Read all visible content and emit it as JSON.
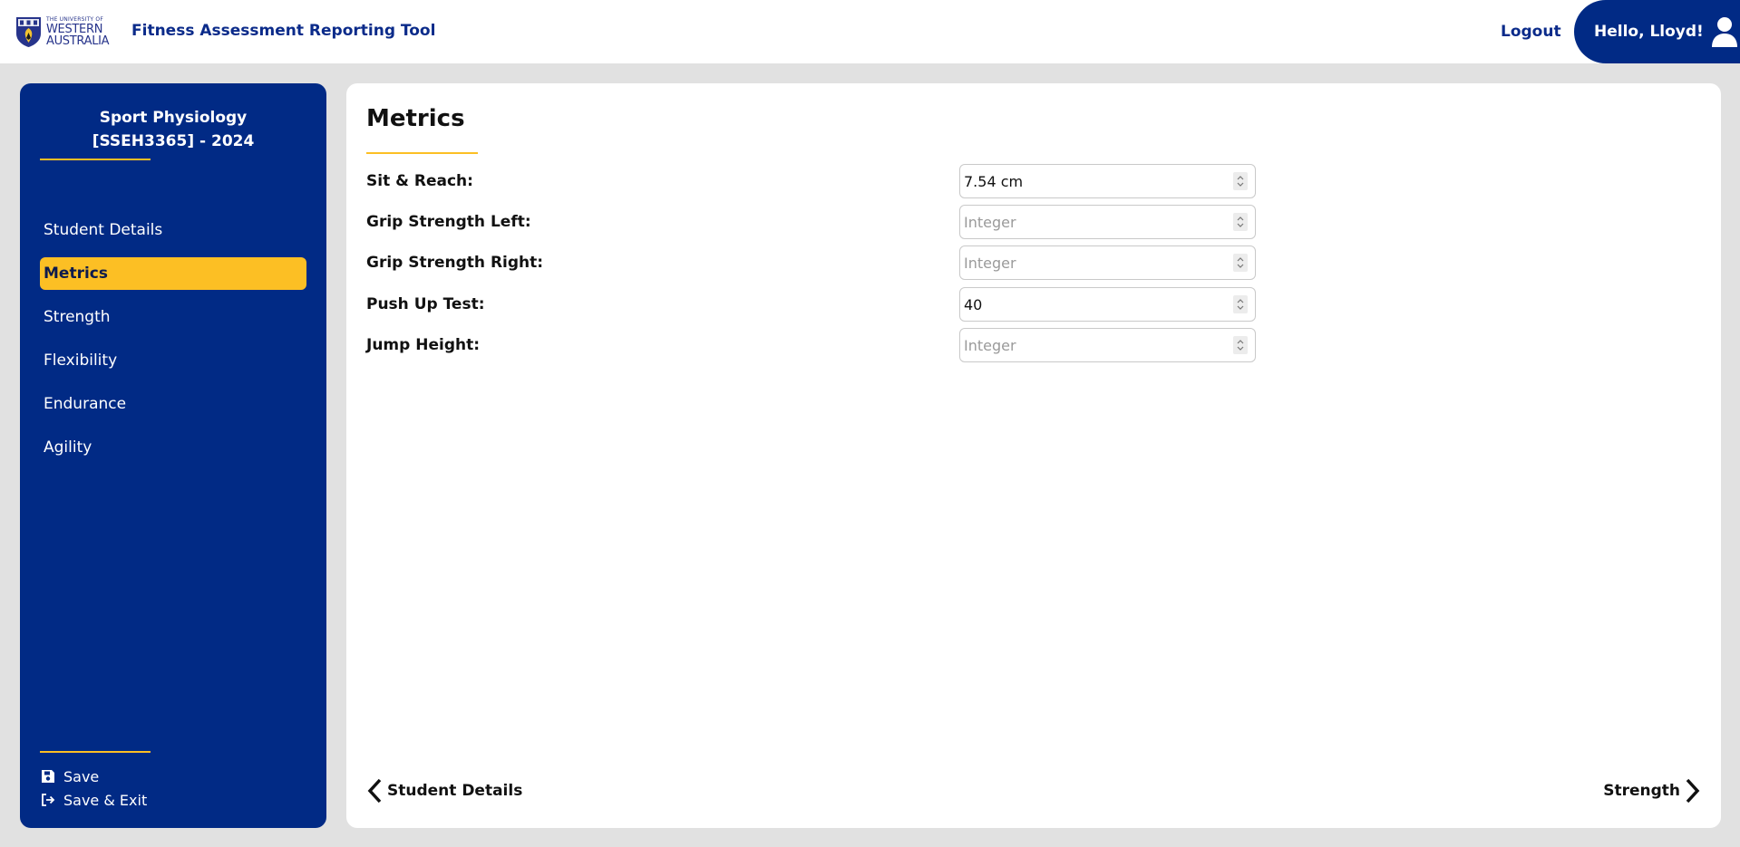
{
  "header": {
    "logo": {
      "line1": "THE UNIVERSITY OF",
      "line2": "WESTERN",
      "line3": "AUSTRALIA",
      "icon": "university-crest-icon"
    },
    "app_title": "Fitness Assessment Reporting Tool",
    "logout_label": "Logout",
    "greeting": "Hello, Lloyd!",
    "user_icon": "user-icon"
  },
  "sidebar": {
    "course_title": "Sport Physiology [SSEH3365] - 2024",
    "items": [
      {
        "label": "Student Details",
        "active": false
      },
      {
        "label": "Metrics",
        "active": true
      },
      {
        "label": "Strength",
        "active": false
      },
      {
        "label": "Flexibility",
        "active": false
      },
      {
        "label": "Endurance",
        "active": false
      },
      {
        "label": "Agility",
        "active": false
      }
    ],
    "actions": {
      "save_label": "Save",
      "save_icon": "floppy-disk-icon",
      "save_exit_label": "Save & Exit",
      "save_exit_icon": "sign-out-icon"
    }
  },
  "main": {
    "title": "Metrics",
    "fields": [
      {
        "label": "Sit & Reach:",
        "value": "7.54 cm",
        "placeholder": "Integer"
      },
      {
        "label": "Grip Strength Left:",
        "value": "",
        "placeholder": "Integer"
      },
      {
        "label": "Grip Strength Right:",
        "value": "",
        "placeholder": "Integer"
      },
      {
        "label": "Push Up Test:",
        "value": "40",
        "placeholder": "Integer"
      },
      {
        "label": "Jump Height:",
        "value": "",
        "placeholder": "Integer"
      }
    ],
    "prev_label": "Student Details",
    "next_label": "Strength"
  },
  "colors": {
    "brand_blue": "#012a85",
    "accent_gold": "#fcbf24",
    "background": "#e1e1e1"
  }
}
